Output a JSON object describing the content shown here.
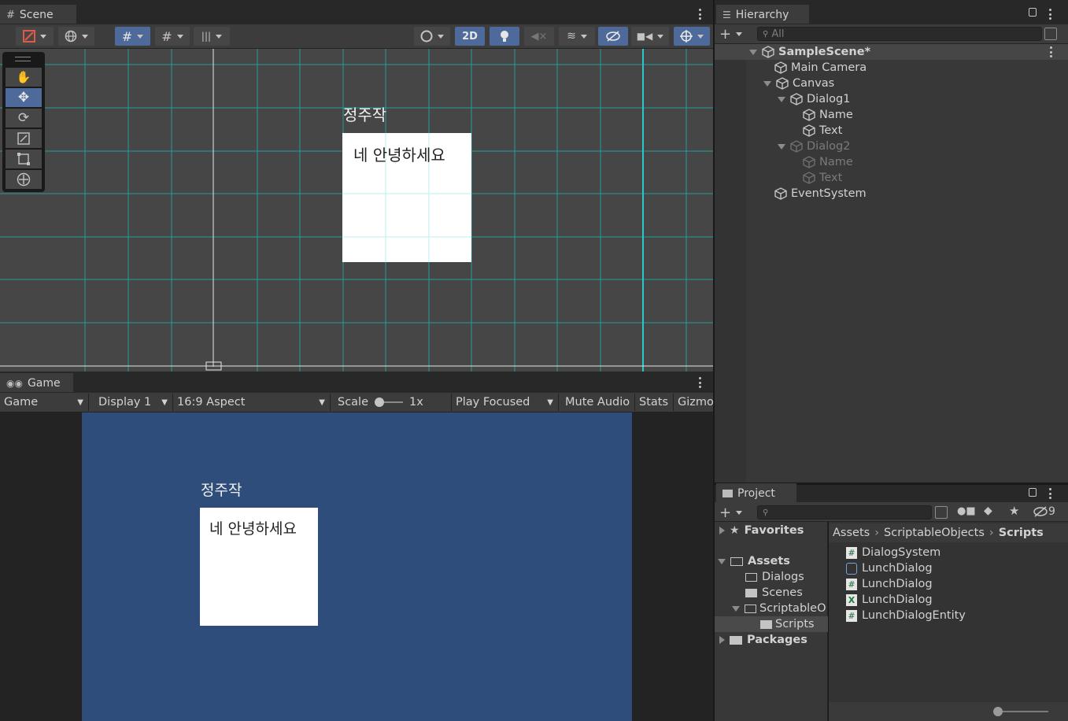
{
  "scene": {
    "tab_label": "Scene",
    "toolbar": {
      "btn_2d": "2D"
    },
    "canvas_name": "정주작",
    "canvas_text": "네 안녕하세요"
  },
  "hierarchy": {
    "tab_label": "Hierarchy",
    "search_placeholder": "All",
    "items": [
      {
        "label": "SampleScene*",
        "depth": 0,
        "expanded": true,
        "bold": true,
        "dim": false
      },
      {
        "label": "Main Camera",
        "depth": 1,
        "expanded": null,
        "bold": false,
        "dim": false
      },
      {
        "label": "Canvas",
        "depth": 1,
        "expanded": true,
        "bold": false,
        "dim": false
      },
      {
        "label": "Dialog1",
        "depth": 2,
        "expanded": true,
        "bold": false,
        "dim": false
      },
      {
        "label": "Name",
        "depth": 3,
        "expanded": null,
        "bold": false,
        "dim": false
      },
      {
        "label": "Text",
        "depth": 3,
        "expanded": null,
        "bold": false,
        "dim": false
      },
      {
        "label": "Dialog2",
        "depth": 2,
        "expanded": true,
        "bold": false,
        "dim": true
      },
      {
        "label": "Name",
        "depth": 3,
        "expanded": null,
        "bold": false,
        "dim": true
      },
      {
        "label": "Text",
        "depth": 3,
        "expanded": null,
        "bold": false,
        "dim": true
      },
      {
        "label": "EventSystem",
        "depth": 1,
        "expanded": null,
        "bold": false,
        "dim": false
      }
    ]
  },
  "game": {
    "tab_label": "Game",
    "toolbar": {
      "mode": "Game",
      "display": "Display 1",
      "aspect": "16:9 Aspect",
      "scale_label": "Scale",
      "scale_value": "1x",
      "play_mode": "Play Focused",
      "mute": "Mute Audio",
      "stats": "Stats",
      "gizmos": "Gizmo"
    },
    "background_color": "#2f4d7a",
    "name_text": "정주작",
    "dialog_text": "네 안녕하세요"
  },
  "project": {
    "tab_label": "Project",
    "hidden_count": "9",
    "tree": {
      "favorites": "Favorites",
      "assets": "Assets",
      "dialogs": "Dialogs",
      "scenes": "Scenes",
      "scriptable": "ScriptableO",
      "scripts": "Scripts",
      "packages": "Packages"
    },
    "breadcrumb": [
      "Assets",
      "ScriptableObjects",
      "Scripts"
    ],
    "files": [
      {
        "name": "DialogSystem",
        "icon": "cs-script-icon"
      },
      {
        "name": "LunchDialog",
        "icon": "scriptable-object-icon"
      },
      {
        "name": "LunchDialog",
        "icon": "cs-script-icon"
      },
      {
        "name": "LunchDialog",
        "icon": "excel-file-icon"
      },
      {
        "name": "LunchDialogEntity",
        "icon": "cs-script-icon"
      }
    ]
  }
}
